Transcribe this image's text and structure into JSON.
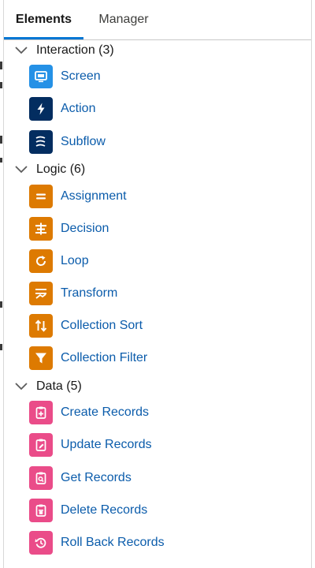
{
  "tabs": [
    {
      "label": "Elements"
    },
    {
      "label": "Manager"
    }
  ],
  "sections": [
    {
      "label": "Interaction (3)",
      "items": [
        {
          "label": "Screen",
          "icon": "screen-icon",
          "color": "#2591e6"
        },
        {
          "label": "Action",
          "icon": "lightning-icon",
          "color": "#032d60"
        },
        {
          "label": "Subflow",
          "icon": "subflow-icon",
          "color": "#032d60"
        }
      ]
    },
    {
      "label": "Logic (6)",
      "items": [
        {
          "label": "Assignment",
          "icon": "equals-icon",
          "color": "#dd7a01"
        },
        {
          "label": "Decision",
          "icon": "decision-icon",
          "color": "#dd7a01"
        },
        {
          "label": "Loop",
          "icon": "loop-icon",
          "color": "#dd7a01"
        },
        {
          "label": "Transform",
          "icon": "transform-icon",
          "color": "#dd7a01"
        },
        {
          "label": "Collection Sort",
          "icon": "sort-icon",
          "color": "#dd7a01"
        },
        {
          "label": "Collection Filter",
          "icon": "filter-icon",
          "color": "#dd7a01"
        }
      ]
    },
    {
      "label": "Data (5)",
      "items": [
        {
          "label": "Create Records",
          "icon": "create-records-icon",
          "color": "#ea4c89"
        },
        {
          "label": "Update Records",
          "icon": "update-records-icon",
          "color": "#ea4c89"
        },
        {
          "label": "Get Records",
          "icon": "get-records-icon",
          "color": "#ea4c89"
        },
        {
          "label": "Delete Records",
          "icon": "delete-records-icon",
          "color": "#ea4c89"
        },
        {
          "label": "Roll Back Records",
          "icon": "rollback-icon",
          "color": "#ea4c89"
        }
      ]
    }
  ]
}
